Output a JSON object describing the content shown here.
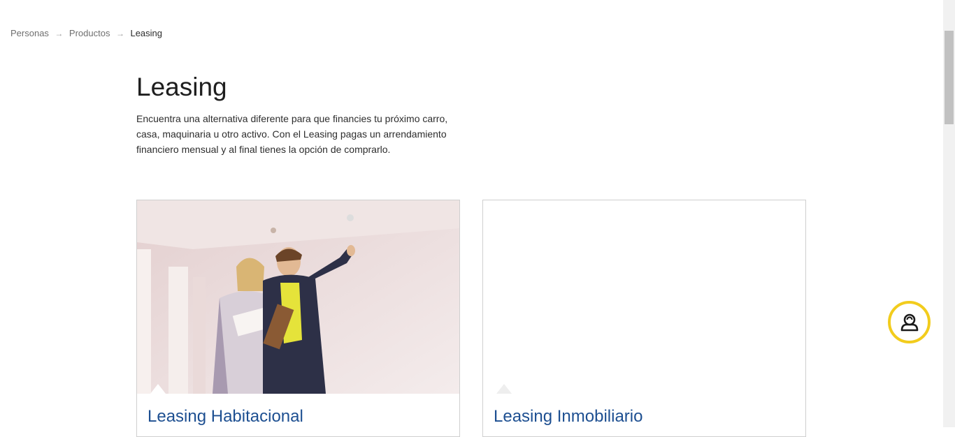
{
  "breadcrumb": {
    "items": [
      "Personas",
      "Productos",
      "Leasing"
    ],
    "separator": "→"
  },
  "page": {
    "title": "Leasing",
    "intro": "Encuentra una alternativa diferente para que financies tu próximo carro, casa, maquinaria u otro activo. Con el Leasing pagas un arrendamiento financiero mensual y al final tienes la opción de comprarlo."
  },
  "cards": [
    {
      "title": "Leasing Habitacional"
    },
    {
      "title": "Leasing Inmobiliario"
    }
  ],
  "assistant": {
    "icon": "chat-agent-icon",
    "accent": "#f2cc1d"
  },
  "colors": {
    "link": "#1d4f91",
    "text": "#2d2d2d",
    "muted": "#6f6f6f"
  }
}
